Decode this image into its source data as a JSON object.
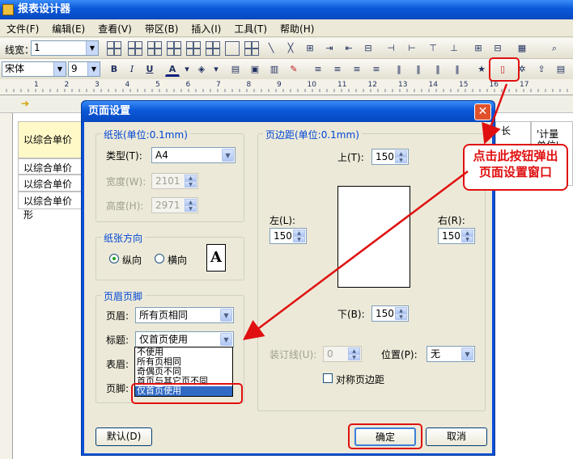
{
  "app": {
    "title": "报表设计器"
  },
  "menu": [
    "文件(F)",
    "编辑(E)",
    "查看(V)",
    "带区(B)",
    "插入(I)",
    "工具(T)",
    "帮助(H)"
  ],
  "toolbar1": {
    "linewidth_label": "线宽：",
    "linewidth_value": "1"
  },
  "toolbar2": {
    "font": "宋体",
    "size": "9",
    "bold": "B",
    "italic": "I",
    "underline": "U",
    "font_color": "A"
  },
  "ruler": {
    "marks": [
      "1",
      "2",
      "3",
      "4",
      "5",
      "6",
      "7",
      "8",
      "9",
      "10",
      "11",
      "12",
      "13",
      "14",
      "15",
      "16",
      "17"
    ]
  },
  "sheet": {
    "cells": [
      "以综合单价形",
      "以综合单价形",
      "以综合单价形",
      "以综合单价形"
    ],
    "right_header": "'计量",
    "right_header2": "单位'",
    "right_cell": "长"
  },
  "dialog": {
    "title": "页面设置",
    "paper": {
      "group": "纸张(单位:0.1mm)",
      "type_label": "类型(T):",
      "type_value": "A4",
      "width_label": "宽度(W):",
      "width_value": "2101",
      "height_label": "高度(H):",
      "height_value": "2971"
    },
    "orientation": {
      "group": "纸张方向",
      "portrait": "纵向",
      "landscape": "横向",
      "preview_letter": "A"
    },
    "margins": {
      "group": "页边距(单位:0.1mm)",
      "top_label": "上(T):",
      "top_value": "150",
      "left_label": "左(L):",
      "left_value": "150",
      "right_label": "右(R):",
      "right_value": "150",
      "bottom_label": "下(B):",
      "bottom_value": "150",
      "gutter_label": "装订线(U):",
      "gutter_value": "0",
      "position_label": "位置(P):",
      "position_value": "无",
      "symmetric_label": "对称页边距"
    },
    "header_footer": {
      "group": "页眉页脚",
      "header_label": "页眉:",
      "header_value": "所有页相同",
      "caption_label": "标题:",
      "caption_value": "仅首页使用",
      "table_header_label": "表眉:",
      "footer_label": "页脚:",
      "options": [
        "不使用",
        "所有页相同",
        "奇偶页不同",
        "首页与其它页不同",
        "仅首页使用"
      ]
    },
    "buttons": {
      "default": "默认(D)",
      "ok": "确定",
      "cancel": "取消"
    }
  },
  "annotation": {
    "line1": "点击此按钮弹出",
    "line2": "页面设置窗口"
  }
}
